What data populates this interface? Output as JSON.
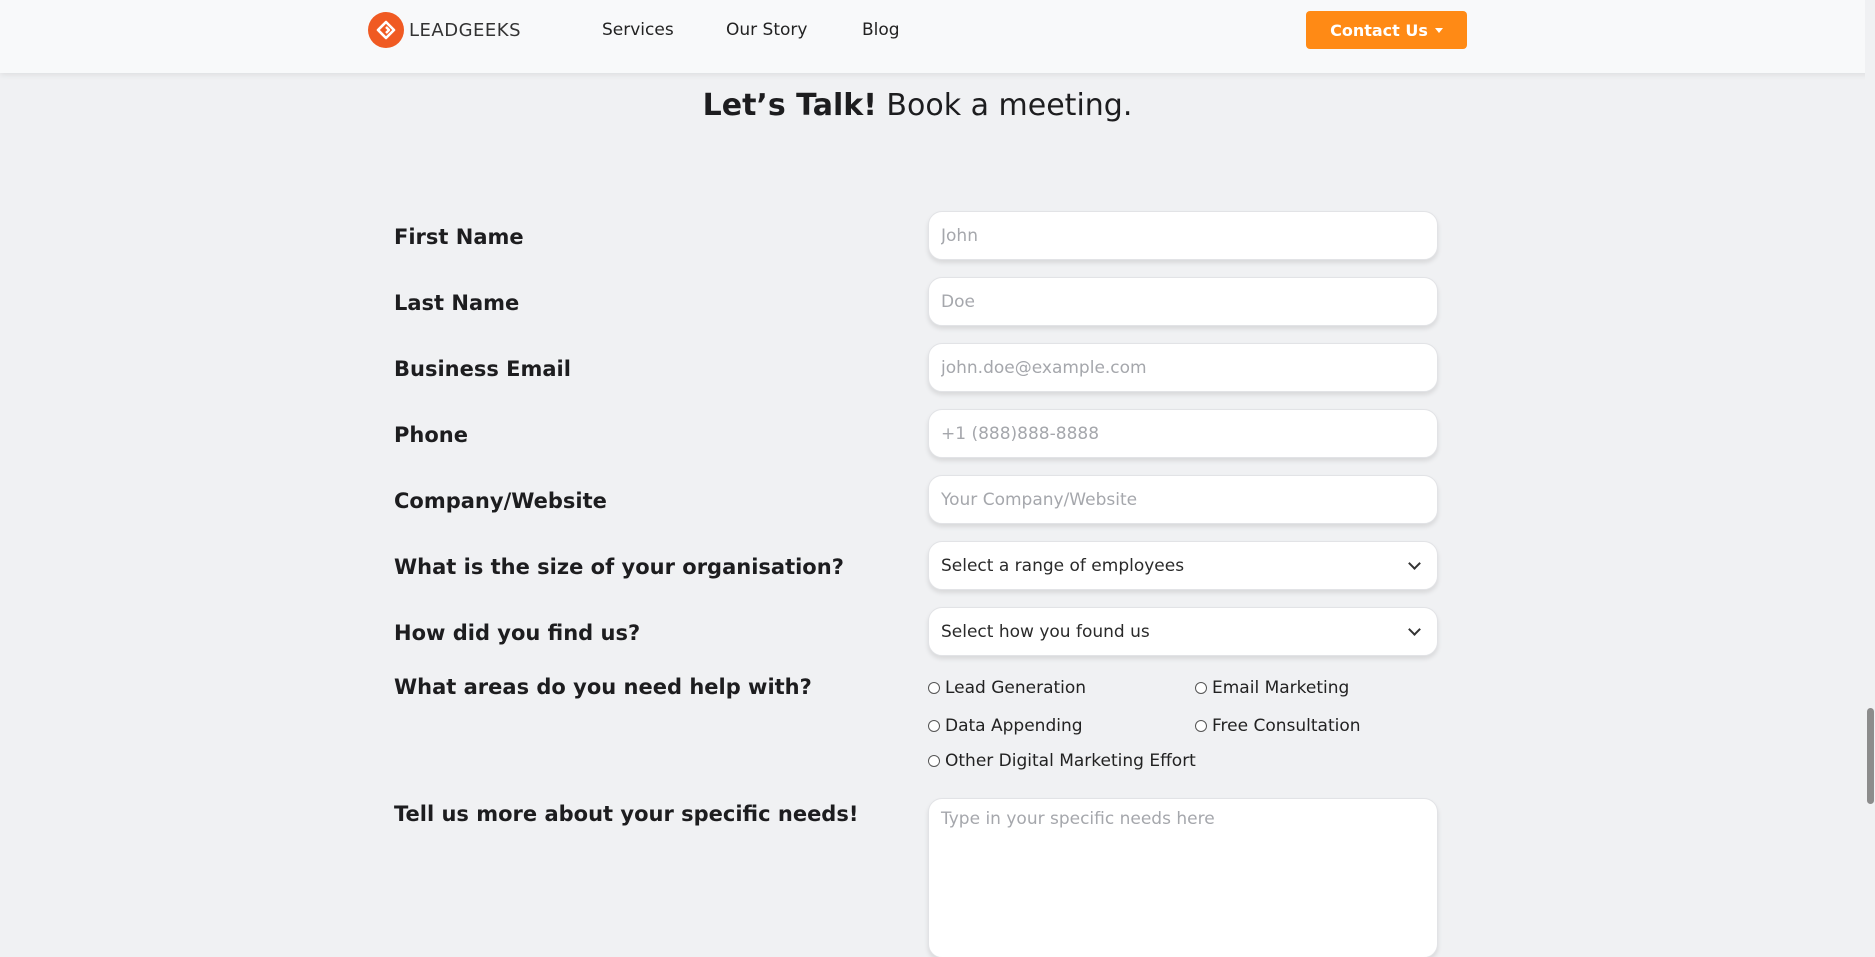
{
  "nav": {
    "brand": "LEADGEEKS",
    "links": [
      "Services",
      "Our Story",
      "Blog"
    ],
    "contact_label": "Contact Us",
    "accent": "#ff8a15",
    "logo_color": "#f05a22"
  },
  "heading": {
    "bold": "Let’s Talk!",
    "rest": " Book a meeting."
  },
  "form": {
    "first_name": {
      "label": "First Name",
      "placeholder": "John"
    },
    "last_name": {
      "label": "Last Name",
      "placeholder": "Doe"
    },
    "email": {
      "label": "Business Email",
      "placeholder": "john.doe@example.com"
    },
    "phone": {
      "label": "Phone",
      "placeholder": "+1 (888)888-8888"
    },
    "company": {
      "label": "Company/Website",
      "placeholder": "Your Company/Website"
    },
    "org_size": {
      "label": "What is the size of your organisation?",
      "selected": "Select a range of employees"
    },
    "found_us": {
      "label": "How did you find us?",
      "selected": "Select how you found us"
    },
    "areas": {
      "label": "What areas do you need help with?",
      "options": [
        "Lead Generation",
        "Email Marketing",
        "Data Appending",
        "Free Consultation",
        "Other Digital Marketing Effort"
      ]
    },
    "needs": {
      "label": "Tell us more about your specific needs!",
      "placeholder": "Type in your specific needs here"
    }
  }
}
